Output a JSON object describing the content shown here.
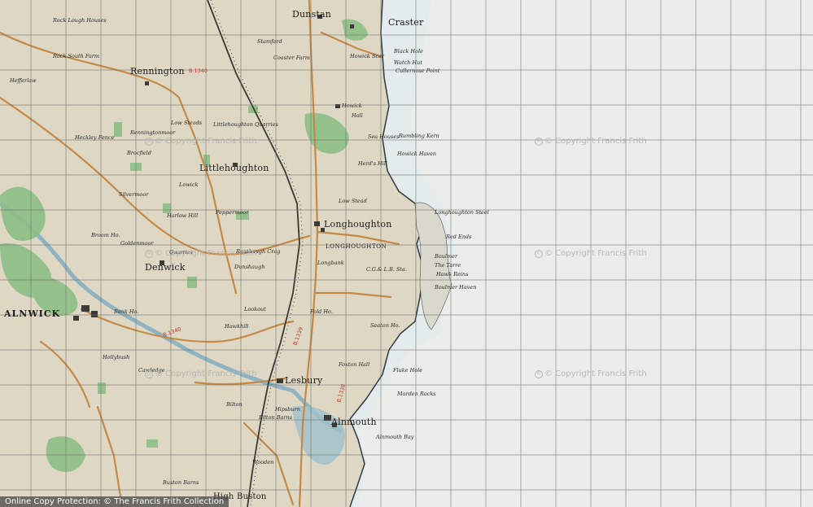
{
  "map": {
    "places_major": [
      "Dunstan",
      "Craster",
      "Rennington",
      "Littlehoughton",
      "Longhoughton",
      "Denwick",
      "Lesbury",
      "Alnmouth",
      "ALNWICK"
    ],
    "places_minor": [
      "Howick",
      "Hall",
      "Littlehoughton Quarries",
      "Peppermoor",
      "Harlow Hill",
      "Rock Lough Houses",
      "Rock South Farm",
      "Stamford",
      "Coaster Farm",
      "Howick Scar",
      "Black Hole",
      "Watch Hut",
      "Cullernose Point",
      "Rumbling Kern",
      "Sea Houses",
      "Howick Haven",
      "Low Stead",
      "Longhoughton Steel",
      "Red Ends",
      "The Tarre",
      "Hawk Reins",
      "Boulmer Haven",
      "C.G.& L.B. Sta.",
      "Longbank",
      "Fold Ho.",
      "Seaton Ho.",
      "Foxton Hall",
      "Fluke Hole",
      "Marden Rocks",
      "Alnmouth Bay",
      "Hawkhill",
      "Lookout",
      "Cawledge",
      "Bilton",
      "Wooden",
      "Buston Barns",
      "High Buston",
      "Boulmer",
      "Broom Ho.",
      "Quarries",
      "Dunshaugh",
      "Rasshaugh Crag",
      "Bilton Barns",
      "Hipsburn",
      "Herd's Hill",
      "Goldenmoor",
      "Bank Ho.",
      "Heckley Fence",
      "Brocfield",
      "Renningtonmoor",
      "Silvermoor",
      "Lowick",
      "Low Steads",
      "Hefferlaw",
      "Hollybush"
    ],
    "area_label": "LONGHOUGHTON",
    "roads": [
      "B.1340",
      "B.1339",
      "B.1338",
      "B.1340"
    ],
    "river": "Aln",
    "colors": {
      "paper": "#ecedeb",
      "land": "#ddd7c3",
      "woodland": "#8dbf86",
      "road": "#c58a48",
      "sea": "#cfe3ea",
      "grid": "#6c6c68",
      "footer_bg": "#464646"
    }
  },
  "watermarks": [
    "© Copyright Francis Frith",
    "© Copyright Francis Frith",
    "© Copyright Francis Frith",
    "© Copyright Francis Frith",
    "© Copyright Francis Frith",
    "© Copyright Francis Frith"
  ],
  "footer": "Online Copy Protection: © The Francis Frith Collection"
}
